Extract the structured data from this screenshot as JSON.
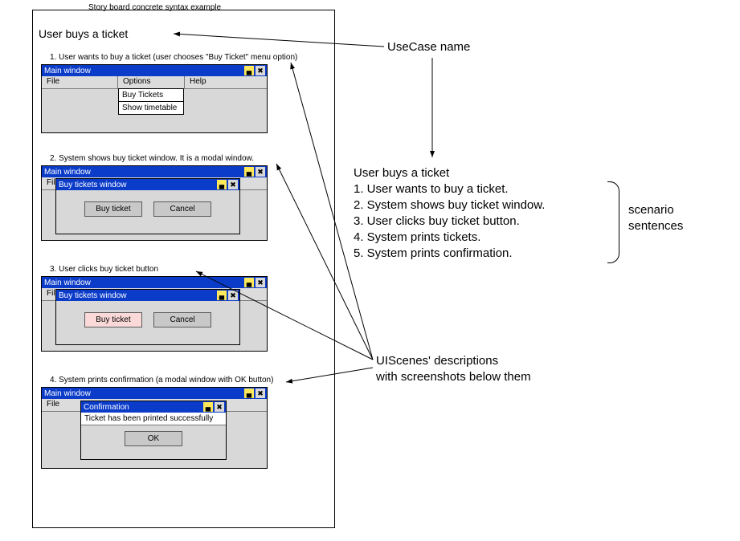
{
  "storyboard": {
    "title": "Story board concrete syntax example",
    "usecase_name": "User buys a ticket"
  },
  "steps": {
    "s1": {
      "label": "1. User wants to buy a ticket (user chooses \"Buy Ticket\" menu option)",
      "win_title": "Main window",
      "menu": {
        "file": "File",
        "options": "Options",
        "help": "Help"
      },
      "dropdown": {
        "buy": "Buy Tickets",
        "tt": "Show timetable"
      }
    },
    "s2": {
      "label": "2. System shows buy ticket window. It is a modal window.",
      "win_title": "Main window",
      "menu_file_short": "File",
      "dialog_title": "Buy tickets window",
      "btn_buy": "Buy ticket",
      "btn_cancel": "Cancel"
    },
    "s3": {
      "label": "3. User clicks buy ticket button",
      "win_title": "Main window",
      "menu_file_short": "File",
      "dialog_title": "Buy tickets window",
      "btn_buy": "Buy ticket",
      "btn_cancel": "Cancel"
    },
    "s4": {
      "label": "4. System prints confirmation (a modal window with OK button)",
      "win_title": "Main window",
      "menu_file": "File",
      "dialog_title": "Confirmation",
      "message": "Ticket has been printed successfully",
      "btn_ok": "OK"
    }
  },
  "annotations": {
    "usecase_label": "UseCase name",
    "scenario": {
      "heading": "User buys a ticket",
      "lines": {
        "l1": "1. User wants to buy a ticket.",
        "l2": "2. System shows buy ticket window.",
        "l3": "3. User clicks buy ticket button.",
        "l4": "4. System prints tickets.",
        "l5": "5. System prints confirmation."
      },
      "bracket_label": "scenario\nsentences"
    },
    "uiscenes_label": "UIScenes' descriptions\nwith screenshots below them"
  },
  "icons": {
    "min": "▄",
    "close": "✖"
  }
}
